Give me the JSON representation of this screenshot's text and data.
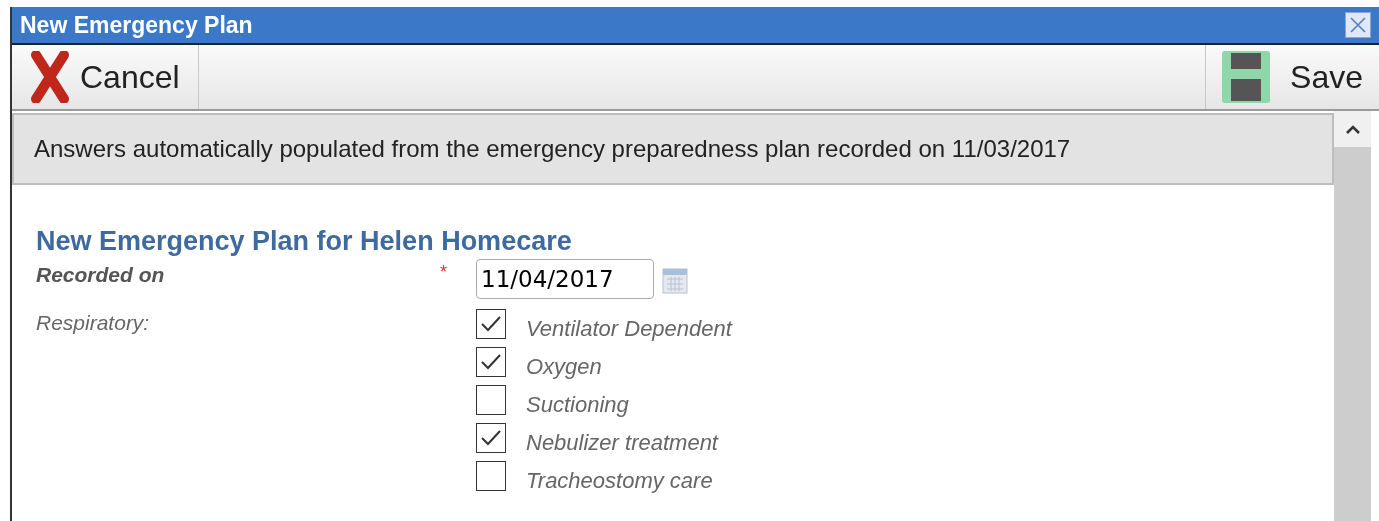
{
  "window": {
    "title": "New Emergency Plan"
  },
  "toolbar": {
    "cancel": "Cancel",
    "save": "Save"
  },
  "notice": "Answers automatically populated from the emergency preparedness plan recorded on 11/03/2017",
  "form": {
    "heading": "New Emergency Plan for Helen Homecare",
    "recorded_on": {
      "label": "Recorded on",
      "required_mark": "*",
      "value": "11/04/2017"
    },
    "respiratory": {
      "label": "Respiratory:",
      "options": [
        {
          "label": "Ventilator Dependent",
          "checked": true
        },
        {
          "label": "Oxygen",
          "checked": true
        },
        {
          "label": "Suctioning",
          "checked": false
        },
        {
          "label": "Nebulizer treatment",
          "checked": true
        },
        {
          "label": "Tracheostomy care",
          "checked": false
        }
      ]
    }
  }
}
